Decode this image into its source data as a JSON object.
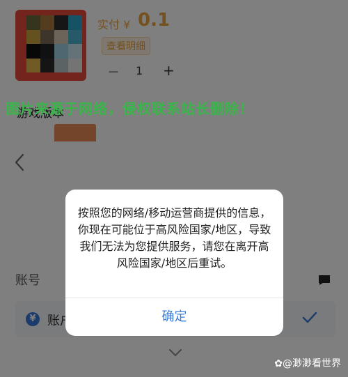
{
  "product": {
    "price_label": "实付 ¥",
    "price_value": "0.1",
    "detail_button": "查看明细",
    "quantity_minus": "－",
    "quantity": "1",
    "quantity_plus": "+",
    "game_version": "游戏版本"
  },
  "watermark_text": "图片来源于网络，侵权联系站长删除！",
  "sheet": {
    "account_label": "账号",
    "account_row_text": "账户",
    "yen_symbol": "¥"
  },
  "dialog": {
    "message": "按照您的网络/移动运营商提供的信息，你现在可能位于高风险国家/地区，导致我们无法为您提供服务，请您在离开高风险国家/地区后重试。",
    "confirm_label": "确定"
  },
  "corner_watermark": "✿@渺渺看世界",
  "colors": {
    "price": "#e8a23e",
    "watermark": "#39b54a",
    "accent": "#3a7bd5"
  }
}
